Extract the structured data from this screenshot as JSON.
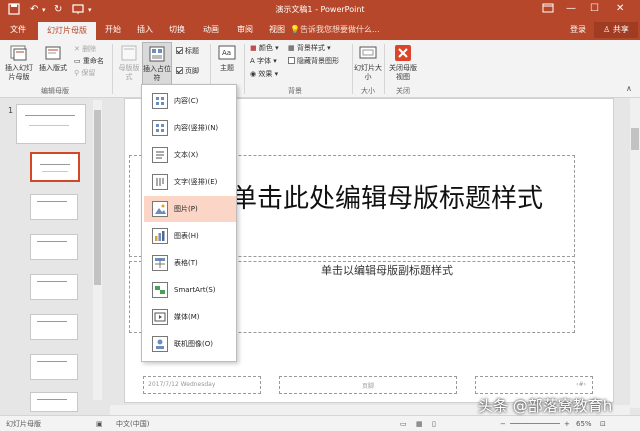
{
  "titlebar": {
    "title": "演示文稿1 - PowerPoint",
    "save_icon": "save-icon",
    "undo_icon": "undo-icon",
    "redo_icon": "redo-icon"
  },
  "tabs": {
    "items": [
      "文件",
      "幻灯片母版",
      "开始",
      "插入",
      "切换",
      "动画",
      "审阅",
      "视图"
    ],
    "active": "幻灯片母版",
    "tell_me": "告诉我您想要做什么...",
    "login": "登录",
    "share": "共享"
  },
  "ribbon": {
    "insert_master": "插入幻灯片母版",
    "insert_layout": "插入版式",
    "delete": "删除",
    "rename": "重命名",
    "preserve": "保留",
    "group_edit_master": "编辑母版",
    "master_layout": "母版版式",
    "insert_placeholder": "插入占位符",
    "title_check": "标题",
    "footer_check": "页脚",
    "theme": "主题",
    "colors": "颜色",
    "fonts": "字体",
    "effects": "效果",
    "bg_styles": "背景样式",
    "hide_bg": "隐藏背景图形",
    "group_bg": "背景",
    "slide_size": "幻灯片大小",
    "group_size": "大小",
    "close_master": "关闭母版视图",
    "group_close": "关闭"
  },
  "dropdown": {
    "items": [
      "内容(C)",
      "内容(竖排)(N)",
      "文本(X)",
      "文字(竖排)(E)",
      "图片(P)",
      "图表(H)",
      "表格(T)",
      "SmartArt(S)",
      "媒体(M)",
      "联机图像(O)"
    ],
    "highlighted_index": 4
  },
  "thumbs": {
    "first_number": "1"
  },
  "slide": {
    "title": "单击此处编辑母版标题样式",
    "subtitle": "单击以编辑母版副标题样式",
    "date": "2017/7/12 Wednesday",
    "footer": "页脚",
    "page_num": "‹#›"
  },
  "statusbar": {
    "view": "幻灯片母版",
    "lang": "中文(中国)",
    "zoom": "65%"
  },
  "watermark": "头条 @部落窝教育h",
  "colors": {
    "accent": "#b7472a",
    "highlight": "#fbd6c6",
    "close_red": "#d9462a"
  }
}
